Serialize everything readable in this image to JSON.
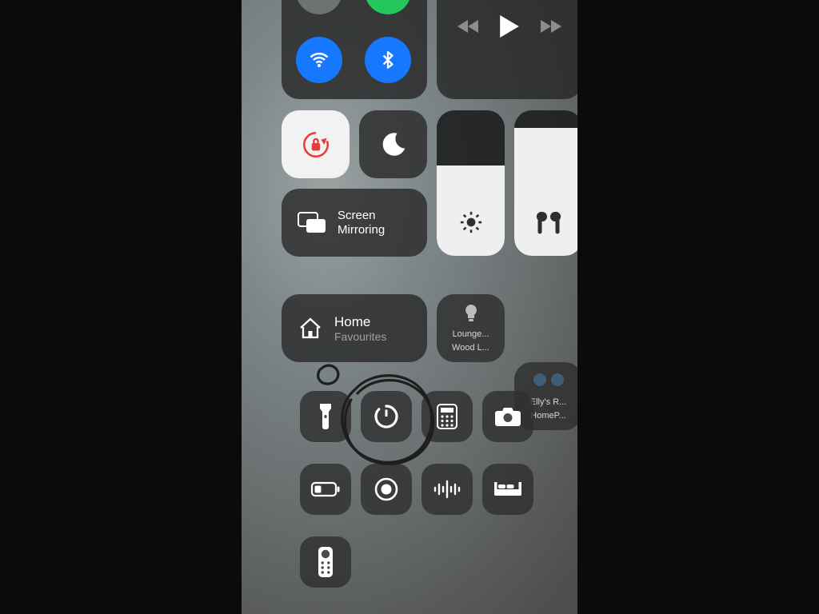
{
  "screen_mirroring_label": "Screen\nMirroring",
  "home": {
    "title": "Home",
    "subtitle": "Favourites"
  },
  "home_tiles": {
    "lounge": {
      "line1": "Lounge...",
      "line2": "Wood L..."
    },
    "ellys": {
      "line1": "Elly's R...",
      "line2": "HomeP..."
    }
  },
  "sliders": {
    "brightness_pct": 62,
    "volume_pct": 88
  },
  "icons": {
    "wifi": "wifi-icon",
    "bluetooth": "bluetooth-icon",
    "airplane": "airplane-icon",
    "cellular": "cellular-icon",
    "back": "rewind-icon",
    "play": "play-icon",
    "fwd": "forward-icon",
    "rotation_lock": "rotation-lock-icon",
    "dnd": "do-not-disturb-icon",
    "mirroring": "screen-mirroring-icon",
    "brightness": "brightness-icon",
    "airpods": "airpods-icon",
    "home": "home-icon",
    "bulb": "lightbulb-icon",
    "flashlight": "flashlight-icon",
    "timer": "timer-icon",
    "calculator": "calculator-icon",
    "camera": "camera-icon",
    "low_power": "low-power-icon",
    "record": "screen-record-icon",
    "voice_memo": "voice-memo-icon",
    "bed": "sleep-icon",
    "remote": "apple-tv-remote-icon"
  }
}
